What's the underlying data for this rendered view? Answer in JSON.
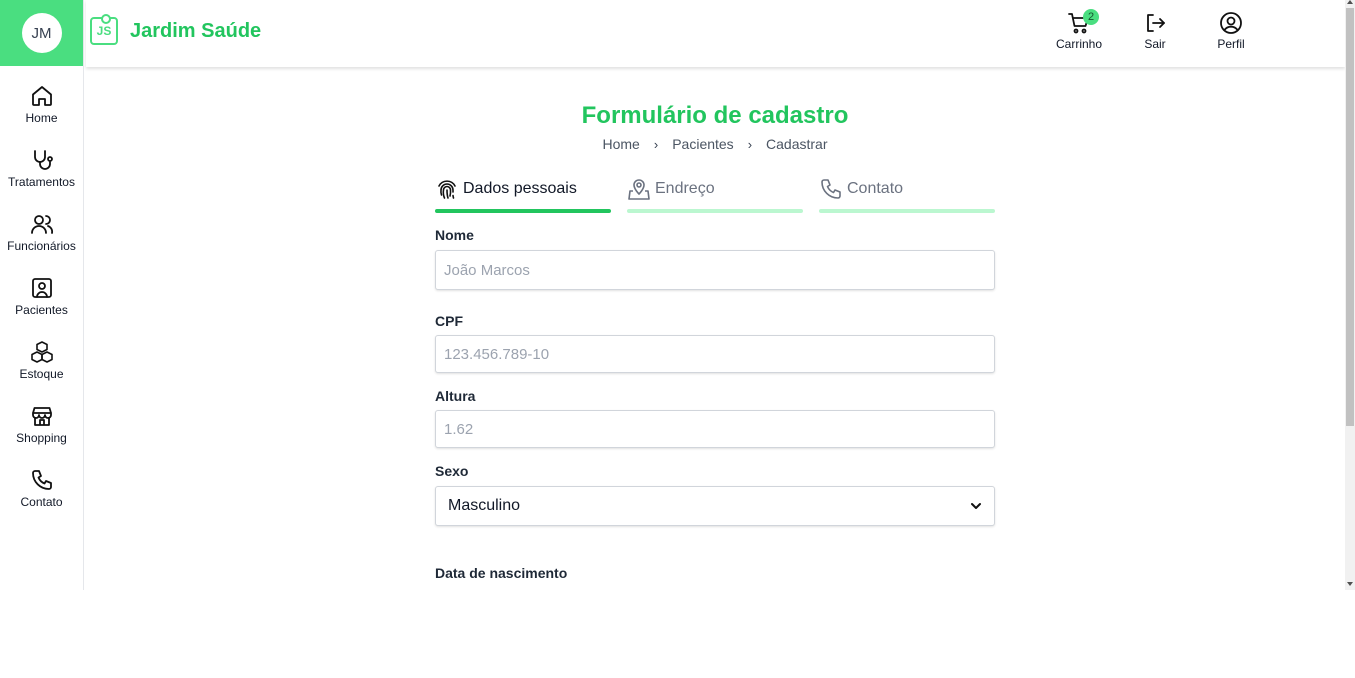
{
  "user": {
    "initials": "JM"
  },
  "brand": {
    "logo_text": "JS",
    "name": "Jardim Saúde"
  },
  "sidebar": {
    "items": [
      {
        "label": "Home",
        "icon": "home-icon"
      },
      {
        "label": "Tratamentos",
        "icon": "stethoscope-icon"
      },
      {
        "label": "Funcionários",
        "icon": "users-icon"
      },
      {
        "label": "Pacientes",
        "icon": "patient-icon"
      },
      {
        "label": "Estoque",
        "icon": "cubes-icon"
      },
      {
        "label": "Shopping",
        "icon": "store-icon"
      },
      {
        "label": "Contato",
        "icon": "phone-icon"
      }
    ]
  },
  "header": {
    "cart": {
      "label": "Carrinho",
      "count": "2",
      "icon": "cart-icon"
    },
    "logout": {
      "label": "Sair",
      "icon": "logout-icon"
    },
    "profile": {
      "label": "Perfil",
      "icon": "user-circle-icon"
    }
  },
  "page": {
    "title": "Formulário de cadastro",
    "breadcrumb": [
      "Home",
      "Pacientes",
      "Cadastrar"
    ]
  },
  "tabs": [
    {
      "label": "Dados pessoais",
      "icon": "fingerprint-icon",
      "active": true
    },
    {
      "label": "Endreço",
      "icon": "map-pin-icon",
      "active": false
    },
    {
      "label": "Contato",
      "icon": "phone-icon",
      "active": false
    }
  ],
  "form": {
    "nome": {
      "label": "Nome",
      "placeholder": "João Marcos"
    },
    "cpf": {
      "label": "CPF",
      "placeholder": "123.456.789-10"
    },
    "altura": {
      "label": "Altura",
      "placeholder": "1.62"
    },
    "sexo": {
      "label": "Sexo",
      "value": "Masculino"
    },
    "nascimento": {
      "label": "Data de nascimento"
    }
  },
  "colors": {
    "accent": "#22c55e",
    "accent_light": "#4ade80",
    "tab_inactive": "#bbf7d0"
  }
}
